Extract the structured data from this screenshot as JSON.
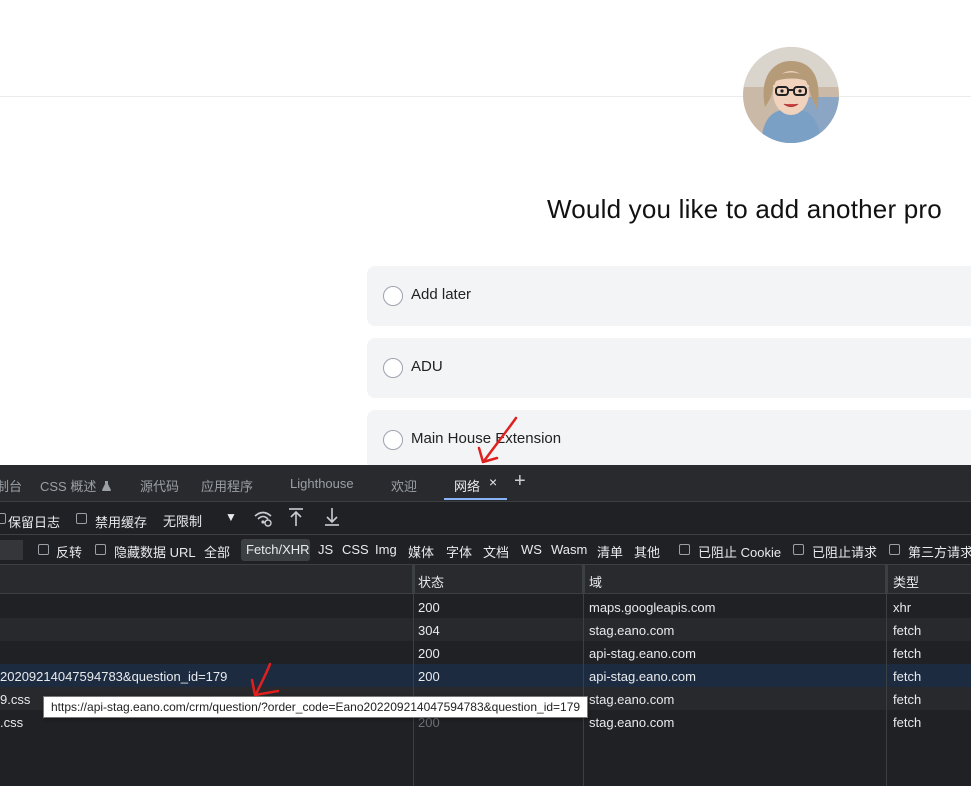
{
  "web": {
    "question": "Would you like to add another pro",
    "options": [
      "Add later",
      "ADU",
      "Main House Extension"
    ]
  },
  "devtools": {
    "tabs": [
      "制台",
      "CSS 概述",
      "源代码",
      "应用程序",
      "Lighthouse",
      "欢迎",
      "网络"
    ],
    "css_overview_icon": "flask-icon",
    "close_glyph": "×",
    "plus_glyph": "+",
    "toolbar": {
      "preserve_log": "保留日志",
      "disable_cache": "禁用缓存",
      "throttle": "无限制",
      "caret": "▼"
    },
    "filters": {
      "invert": "反转",
      "hide_data_url": "隐藏数据 URL",
      "types": [
        "全部",
        "Fetch/XHR",
        "JS",
        "CSS",
        "Img",
        "媒体",
        "字体",
        "文档",
        "WS",
        "Wasm",
        "清单",
        "其他"
      ],
      "blocked_cookie": "已阻止 Cookie",
      "blocked_requests": "已阻止请求",
      "third_party": "第三方请求"
    },
    "columns": [
      "状态",
      "域",
      "类型"
    ],
    "rows": [
      {
        "name": "",
        "status": "200",
        "domain": "maps.googleapis.com",
        "type": "xhr"
      },
      {
        "name": "",
        "status": "304",
        "domain": "stag.eano.com",
        "type": "fetch"
      },
      {
        "name": "",
        "status": "200",
        "domain": "api-stag.eano.com",
        "type": "fetch"
      },
      {
        "name": "20209214047594783&question_id=179",
        "status": "200",
        "domain": "api-stag.eano.com",
        "type": "fetch"
      },
      {
        "name": "9.css",
        "status": "",
        "domain": "stag.eano.com",
        "type": "fetch"
      },
      {
        "name": ".css",
        "status": "200",
        "domain": "stag.eano.com",
        "type": "fetch"
      }
    ],
    "tooltip": "https://api-stag.eano.com/crm/question/?order_code=Eano202209214047594783&question_id=179"
  },
  "colors": {
    "devtools_bg": "#202124",
    "active_tab_underline": "#8ab4f8",
    "selected_row": "#1c2b40",
    "annotation": "#e0201f"
  }
}
